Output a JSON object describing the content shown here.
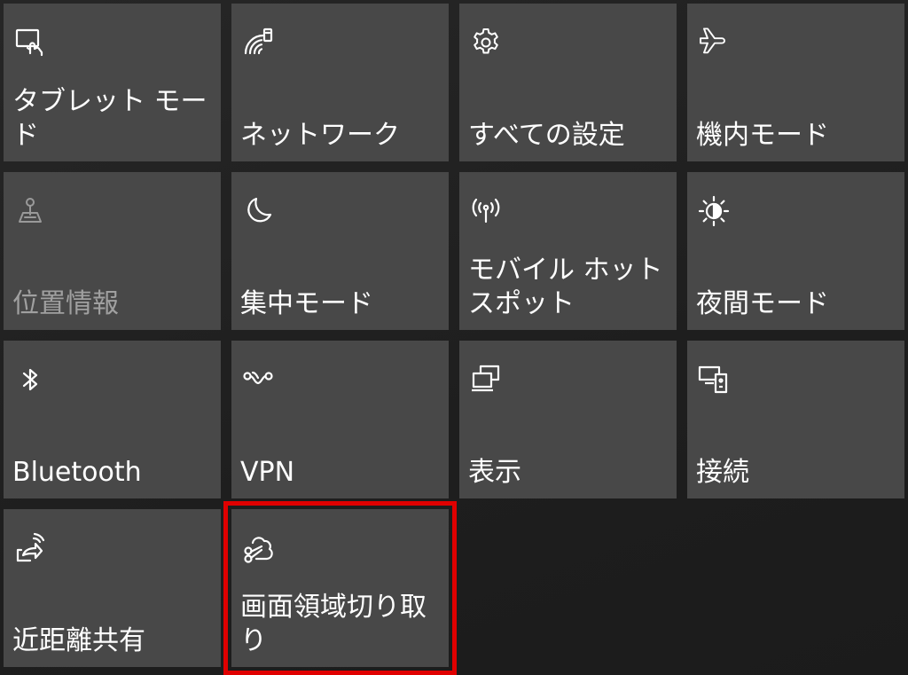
{
  "quick_actions": {
    "tiles": [
      {
        "label": "タブレット モード",
        "icon": "tablet-mode-icon",
        "state": "normal"
      },
      {
        "label": "ネットワーク",
        "icon": "network-icon",
        "state": "normal"
      },
      {
        "label": "すべての設定",
        "icon": "settings-gear-icon",
        "state": "normal"
      },
      {
        "label": "機内モード",
        "icon": "airplane-icon",
        "state": "normal"
      },
      {
        "label": "位置情報",
        "icon": "location-icon",
        "state": "disabled"
      },
      {
        "label": "集中モード",
        "icon": "moon-icon",
        "state": "normal"
      },
      {
        "label": "モバイル ホットスポット",
        "icon": "mobile-hotspot-icon",
        "state": "normal"
      },
      {
        "label": "夜間モード",
        "icon": "sun-icon",
        "state": "normal"
      },
      {
        "label": "Bluetooth",
        "icon": "bluetooth-icon",
        "state": "normal"
      },
      {
        "label": "VPN",
        "icon": "vpn-icon",
        "state": "normal"
      },
      {
        "label": "表示",
        "icon": "project-display-icon",
        "state": "normal"
      },
      {
        "label": "接続",
        "icon": "connect-devices-icon",
        "state": "normal"
      },
      {
        "label": "近距離共有",
        "icon": "nearby-share-icon",
        "state": "normal"
      },
      {
        "label": "画面領域切り取り",
        "icon": "snip-scissors-icon",
        "state": "selected"
      }
    ],
    "highlight_color": "#e00000",
    "tile_color": "#484848"
  }
}
